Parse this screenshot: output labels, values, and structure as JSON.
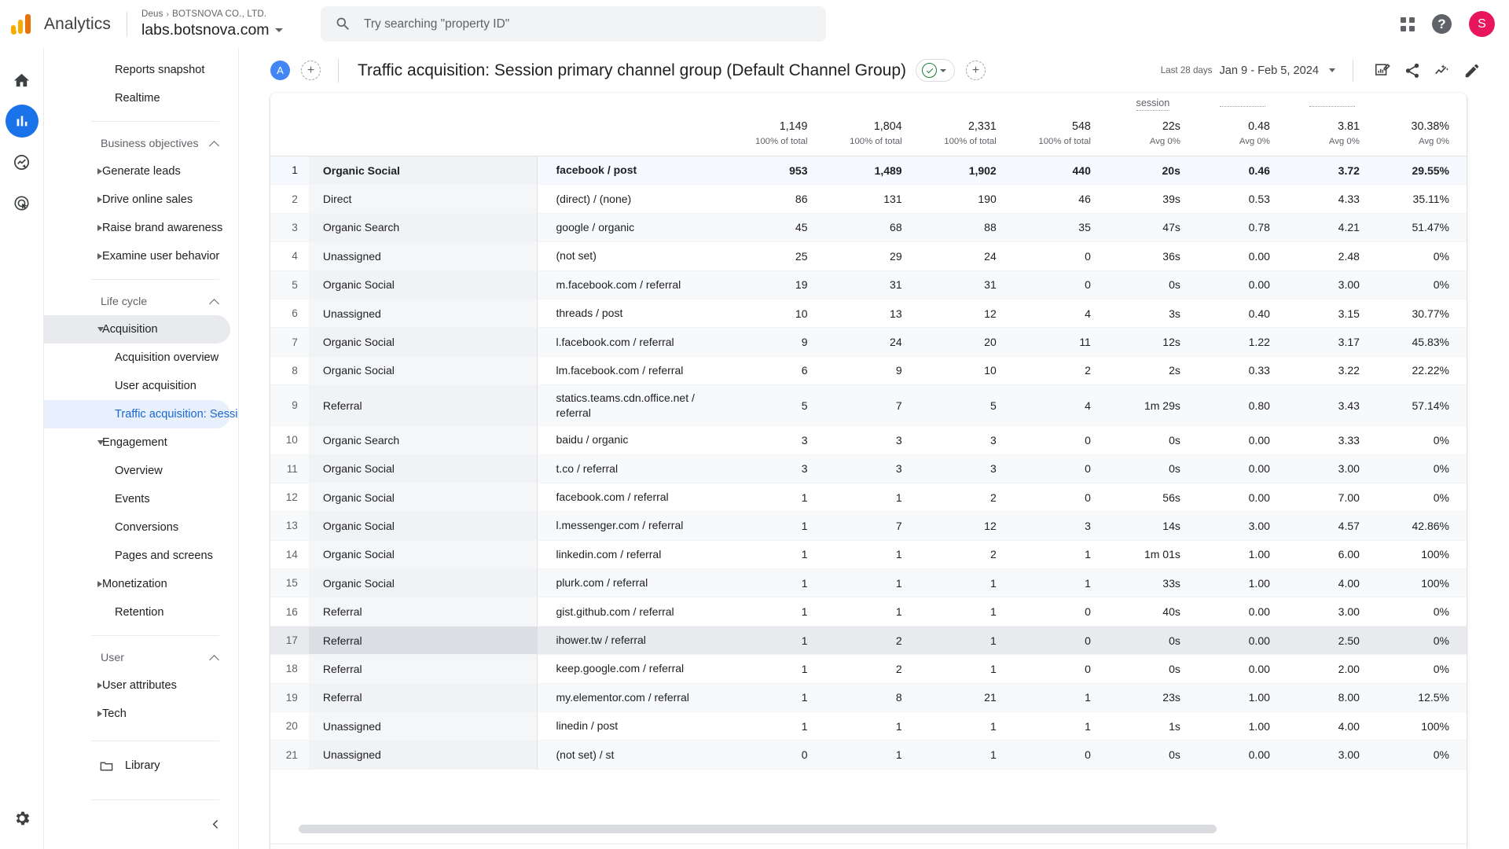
{
  "header": {
    "brand": "Analytics",
    "breadcrumb_account": "Deus",
    "breadcrumb_sep": "›",
    "breadcrumb_org": "BOTSNOVA CO., LTD.",
    "property": "labs.botsnova.com",
    "search_placeholder": "Try searching \"property ID\"",
    "search_value": "",
    "avatar_initial": "S",
    "help_glyph": "?"
  },
  "rail": [
    {
      "name": "home-icon",
      "label": "Home",
      "active": false
    },
    {
      "name": "reports-icon",
      "label": "Reports",
      "active": true
    },
    {
      "name": "explore-icon",
      "label": "Explore",
      "active": false
    },
    {
      "name": "advertising-icon",
      "label": "Advertising",
      "active": false
    }
  ],
  "sidebar": {
    "top_items": [
      {
        "label": "Reports snapshot"
      },
      {
        "label": "Realtime"
      }
    ],
    "groups": [
      {
        "title": "Business objectives",
        "items": [
          {
            "label": "Generate leads",
            "level": 0,
            "arrow": "closed"
          },
          {
            "label": "Drive online sales",
            "level": 0,
            "arrow": "closed"
          },
          {
            "label": "Raise brand awareness",
            "level": 0,
            "arrow": "closed"
          },
          {
            "label": "Examine user behavior",
            "level": 0,
            "arrow": "closed"
          }
        ]
      },
      {
        "title": "Life cycle",
        "items": [
          {
            "label": "Acquisition",
            "level": 0,
            "arrow": "open",
            "expanded": true
          },
          {
            "label": "Acquisition overview",
            "level": 1,
            "arrow": "none"
          },
          {
            "label": "User acquisition",
            "level": 1,
            "arrow": "none"
          },
          {
            "label": "Traffic acquisition: Session...",
            "level": 1,
            "arrow": "none",
            "selected": true
          },
          {
            "label": "Engagement",
            "level": 0,
            "arrow": "open"
          },
          {
            "label": "Overview",
            "level": 1,
            "arrow": "none"
          },
          {
            "label": "Events",
            "level": 1,
            "arrow": "none"
          },
          {
            "label": "Conversions",
            "level": 1,
            "arrow": "none"
          },
          {
            "label": "Pages and screens",
            "level": 1,
            "arrow": "none"
          },
          {
            "label": "Monetization",
            "level": 0,
            "arrow": "closed"
          },
          {
            "label": "Retention",
            "level": 1,
            "arrow": "none"
          }
        ]
      },
      {
        "title": "User",
        "items": [
          {
            "label": "User attributes",
            "level": 0,
            "arrow": "closed"
          },
          {
            "label": "Tech",
            "level": 0,
            "arrow": "closed"
          }
        ]
      }
    ],
    "library_label": "Library"
  },
  "report": {
    "badge": "A",
    "title": "Traffic acquisition: Session primary channel group (Default Channel Group)",
    "date_label": "Last 28 days",
    "date_value": "Jan 9 - Feb 5, 2024"
  },
  "table": {
    "header_fragment": "session",
    "totals": [
      {
        "value": "1,149",
        "sub": "100% of total"
      },
      {
        "value": "1,804",
        "sub": "100% of total"
      },
      {
        "value": "2,331",
        "sub": "100% of total"
      },
      {
        "value": "548",
        "sub": "100% of total"
      },
      {
        "value": "22s",
        "sub": "Avg 0%"
      },
      {
        "value": "0.48",
        "sub": "Avg 0%"
      },
      {
        "value": "3.81",
        "sub": "Avg 0%"
      },
      {
        "value": "30.38%",
        "sub": "Avg 0%"
      }
    ],
    "rows": [
      {
        "n": "1",
        "channel": "Organic Social",
        "source": "facebook / post",
        "m": [
          "953",
          "1,489",
          "1,902",
          "440",
          "20s",
          "0.46",
          "3.72",
          "29.55%"
        ]
      },
      {
        "n": "2",
        "channel": "Direct",
        "source": "(direct) / (none)",
        "m": [
          "86",
          "131",
          "190",
          "46",
          "39s",
          "0.53",
          "4.33",
          "35.11%"
        ]
      },
      {
        "n": "3",
        "channel": "Organic Search",
        "source": "google / organic",
        "m": [
          "45",
          "68",
          "88",
          "35",
          "47s",
          "0.78",
          "4.21",
          "51.47%"
        ]
      },
      {
        "n": "4",
        "channel": "Unassigned",
        "source": "(not set)",
        "m": [
          "25",
          "29",
          "24",
          "0",
          "36s",
          "0.00",
          "2.48",
          "0%"
        ]
      },
      {
        "n": "5",
        "channel": "Organic Social",
        "source": "m.facebook.com / referral",
        "m": [
          "19",
          "31",
          "31",
          "0",
          "0s",
          "0.00",
          "3.00",
          "0%"
        ]
      },
      {
        "n": "6",
        "channel": "Unassigned",
        "source": "threads / post",
        "m": [
          "10",
          "13",
          "12",
          "4",
          "3s",
          "0.40",
          "3.15",
          "30.77%"
        ]
      },
      {
        "n": "7",
        "channel": "Organic Social",
        "source": "l.facebook.com / referral",
        "m": [
          "9",
          "24",
          "20",
          "11",
          "12s",
          "1.22",
          "3.17",
          "45.83%"
        ]
      },
      {
        "n": "8",
        "channel": "Organic Social",
        "source": "lm.facebook.com / referral",
        "m": [
          "6",
          "9",
          "10",
          "2",
          "2s",
          "0.33",
          "3.22",
          "22.22%"
        ]
      },
      {
        "n": "9",
        "channel": "Referral",
        "source": "statics.teams.cdn.office.net / referral",
        "m": [
          "5",
          "7",
          "5",
          "4",
          "1m 29s",
          "0.80",
          "3.43",
          "57.14%"
        ],
        "tall": true
      },
      {
        "n": "10",
        "channel": "Organic Search",
        "source": "baidu / organic",
        "m": [
          "3",
          "3",
          "3",
          "0",
          "0s",
          "0.00",
          "3.33",
          "0%"
        ]
      },
      {
        "n": "11",
        "channel": "Organic Social",
        "source": "t.co / referral",
        "m": [
          "3",
          "3",
          "3",
          "0",
          "0s",
          "0.00",
          "3.00",
          "0%"
        ]
      },
      {
        "n": "12",
        "channel": "Organic Social",
        "source": "facebook.com / referral",
        "m": [
          "1",
          "1",
          "2",
          "0",
          "56s",
          "0.00",
          "7.00",
          "0%"
        ]
      },
      {
        "n": "13",
        "channel": "Organic Social",
        "source": "l.messenger.com / referral",
        "m": [
          "1",
          "7",
          "12",
          "3",
          "14s",
          "3.00",
          "4.57",
          "42.86%"
        ]
      },
      {
        "n": "14",
        "channel": "Organic Social",
        "source": "linkedin.com / referral",
        "m": [
          "1",
          "1",
          "2",
          "1",
          "1m 01s",
          "1.00",
          "6.00",
          "100%"
        ]
      },
      {
        "n": "15",
        "channel": "Organic Social",
        "source": "plurk.com / referral",
        "m": [
          "1",
          "1",
          "1",
          "1",
          "33s",
          "1.00",
          "4.00",
          "100%"
        ]
      },
      {
        "n": "16",
        "channel": "Referral",
        "source": "gist.github.com / referral",
        "m": [
          "1",
          "1",
          "1",
          "0",
          "40s",
          "0.00",
          "3.00",
          "0%"
        ]
      },
      {
        "n": "17",
        "channel": "Referral",
        "source": "ihower.tw / referral",
        "m": [
          "1",
          "2",
          "1",
          "0",
          "0s",
          "0.00",
          "2.50",
          "0%"
        ],
        "hover": true
      },
      {
        "n": "18",
        "channel": "Referral",
        "source": "keep.google.com / referral",
        "m": [
          "1",
          "2",
          "1",
          "0",
          "0s",
          "0.00",
          "2.00",
          "0%"
        ]
      },
      {
        "n": "19",
        "channel": "Referral",
        "source": "my.elementor.com / referral",
        "m": [
          "1",
          "8",
          "21",
          "1",
          "23s",
          "1.00",
          "8.00",
          "12.5%"
        ]
      },
      {
        "n": "20",
        "channel": "Unassigned",
        "source": "linedin / post",
        "m": [
          "1",
          "1",
          "1",
          "1",
          "1s",
          "1.00",
          "4.00",
          "100%"
        ]
      },
      {
        "n": "21",
        "channel": "Unassigned",
        "source": "(not set) / st",
        "m": [
          "0",
          "1",
          "1",
          "0",
          "0s",
          "0.00",
          "3.00",
          "0%"
        ]
      }
    ]
  },
  "colors": {
    "accent": "#1a73e8",
    "brand_orange": "#f9ab00",
    "brand_orange_dark": "#e8710a",
    "avatar": "#e8175d",
    "selected_nav": "#e8f0fe",
    "selected_nav_text": "#1967d2",
    "green_check": "#188038"
  }
}
